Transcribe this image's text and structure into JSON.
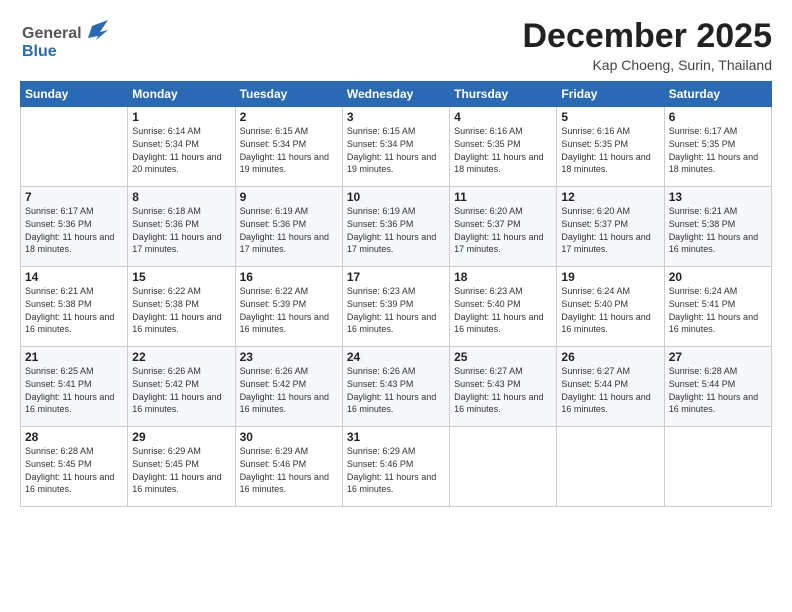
{
  "header": {
    "logo_line1": "General",
    "logo_line2": "Blue",
    "month": "December 2025",
    "location": "Kap Choeng, Surin, Thailand"
  },
  "days_of_week": [
    "Sunday",
    "Monday",
    "Tuesday",
    "Wednesday",
    "Thursday",
    "Friday",
    "Saturday"
  ],
  "weeks": [
    [
      {
        "day": "",
        "sunrise": "",
        "sunset": "",
        "daylight": ""
      },
      {
        "day": "1",
        "sunrise": "Sunrise: 6:14 AM",
        "sunset": "Sunset: 5:34 PM",
        "daylight": "Daylight: 11 hours and 20 minutes."
      },
      {
        "day": "2",
        "sunrise": "Sunrise: 6:15 AM",
        "sunset": "Sunset: 5:34 PM",
        "daylight": "Daylight: 11 hours and 19 minutes."
      },
      {
        "day": "3",
        "sunrise": "Sunrise: 6:15 AM",
        "sunset": "Sunset: 5:34 PM",
        "daylight": "Daylight: 11 hours and 19 minutes."
      },
      {
        "day": "4",
        "sunrise": "Sunrise: 6:16 AM",
        "sunset": "Sunset: 5:35 PM",
        "daylight": "Daylight: 11 hours and 18 minutes."
      },
      {
        "day": "5",
        "sunrise": "Sunrise: 6:16 AM",
        "sunset": "Sunset: 5:35 PM",
        "daylight": "Daylight: 11 hours and 18 minutes."
      },
      {
        "day": "6",
        "sunrise": "Sunrise: 6:17 AM",
        "sunset": "Sunset: 5:35 PM",
        "daylight": "Daylight: 11 hours and 18 minutes."
      }
    ],
    [
      {
        "day": "7",
        "sunrise": "Sunrise: 6:17 AM",
        "sunset": "Sunset: 5:36 PM",
        "daylight": "Daylight: 11 hours and 18 minutes."
      },
      {
        "day": "8",
        "sunrise": "Sunrise: 6:18 AM",
        "sunset": "Sunset: 5:36 PM",
        "daylight": "Daylight: 11 hours and 17 minutes."
      },
      {
        "day": "9",
        "sunrise": "Sunrise: 6:19 AM",
        "sunset": "Sunset: 5:36 PM",
        "daylight": "Daylight: 11 hours and 17 minutes."
      },
      {
        "day": "10",
        "sunrise": "Sunrise: 6:19 AM",
        "sunset": "Sunset: 5:36 PM",
        "daylight": "Daylight: 11 hours and 17 minutes."
      },
      {
        "day": "11",
        "sunrise": "Sunrise: 6:20 AM",
        "sunset": "Sunset: 5:37 PM",
        "daylight": "Daylight: 11 hours and 17 minutes."
      },
      {
        "day": "12",
        "sunrise": "Sunrise: 6:20 AM",
        "sunset": "Sunset: 5:37 PM",
        "daylight": "Daylight: 11 hours and 17 minutes."
      },
      {
        "day": "13",
        "sunrise": "Sunrise: 6:21 AM",
        "sunset": "Sunset: 5:38 PM",
        "daylight": "Daylight: 11 hours and 16 minutes."
      }
    ],
    [
      {
        "day": "14",
        "sunrise": "Sunrise: 6:21 AM",
        "sunset": "Sunset: 5:38 PM",
        "daylight": "Daylight: 11 hours and 16 minutes."
      },
      {
        "day": "15",
        "sunrise": "Sunrise: 6:22 AM",
        "sunset": "Sunset: 5:38 PM",
        "daylight": "Daylight: 11 hours and 16 minutes."
      },
      {
        "day": "16",
        "sunrise": "Sunrise: 6:22 AM",
        "sunset": "Sunset: 5:39 PM",
        "daylight": "Daylight: 11 hours and 16 minutes."
      },
      {
        "day": "17",
        "sunrise": "Sunrise: 6:23 AM",
        "sunset": "Sunset: 5:39 PM",
        "daylight": "Daylight: 11 hours and 16 minutes."
      },
      {
        "day": "18",
        "sunrise": "Sunrise: 6:23 AM",
        "sunset": "Sunset: 5:40 PM",
        "daylight": "Daylight: 11 hours and 16 minutes."
      },
      {
        "day": "19",
        "sunrise": "Sunrise: 6:24 AM",
        "sunset": "Sunset: 5:40 PM",
        "daylight": "Daylight: 11 hours and 16 minutes."
      },
      {
        "day": "20",
        "sunrise": "Sunrise: 6:24 AM",
        "sunset": "Sunset: 5:41 PM",
        "daylight": "Daylight: 11 hours and 16 minutes."
      }
    ],
    [
      {
        "day": "21",
        "sunrise": "Sunrise: 6:25 AM",
        "sunset": "Sunset: 5:41 PM",
        "daylight": "Daylight: 11 hours and 16 minutes."
      },
      {
        "day": "22",
        "sunrise": "Sunrise: 6:26 AM",
        "sunset": "Sunset: 5:42 PM",
        "daylight": "Daylight: 11 hours and 16 minutes."
      },
      {
        "day": "23",
        "sunrise": "Sunrise: 6:26 AM",
        "sunset": "Sunset: 5:42 PM",
        "daylight": "Daylight: 11 hours and 16 minutes."
      },
      {
        "day": "24",
        "sunrise": "Sunrise: 6:26 AM",
        "sunset": "Sunset: 5:43 PM",
        "daylight": "Daylight: 11 hours and 16 minutes."
      },
      {
        "day": "25",
        "sunrise": "Sunrise: 6:27 AM",
        "sunset": "Sunset: 5:43 PM",
        "daylight": "Daylight: 11 hours and 16 minutes."
      },
      {
        "day": "26",
        "sunrise": "Sunrise: 6:27 AM",
        "sunset": "Sunset: 5:44 PM",
        "daylight": "Daylight: 11 hours and 16 minutes."
      },
      {
        "day": "27",
        "sunrise": "Sunrise: 6:28 AM",
        "sunset": "Sunset: 5:44 PM",
        "daylight": "Daylight: 11 hours and 16 minutes."
      }
    ],
    [
      {
        "day": "28",
        "sunrise": "Sunrise: 6:28 AM",
        "sunset": "Sunset: 5:45 PM",
        "daylight": "Daylight: 11 hours and 16 minutes."
      },
      {
        "day": "29",
        "sunrise": "Sunrise: 6:29 AM",
        "sunset": "Sunset: 5:45 PM",
        "daylight": "Daylight: 11 hours and 16 minutes."
      },
      {
        "day": "30",
        "sunrise": "Sunrise: 6:29 AM",
        "sunset": "Sunset: 5:46 PM",
        "daylight": "Daylight: 11 hours and 16 minutes."
      },
      {
        "day": "31",
        "sunrise": "Sunrise: 6:29 AM",
        "sunset": "Sunset: 5:46 PM",
        "daylight": "Daylight: 11 hours and 16 minutes."
      },
      {
        "day": "",
        "sunrise": "",
        "sunset": "",
        "daylight": ""
      },
      {
        "day": "",
        "sunrise": "",
        "sunset": "",
        "daylight": ""
      },
      {
        "day": "",
        "sunrise": "",
        "sunset": "",
        "daylight": ""
      }
    ]
  ]
}
